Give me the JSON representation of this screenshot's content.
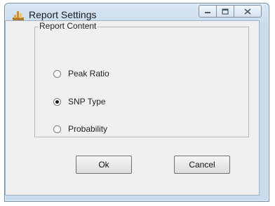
{
  "window": {
    "title": "Report Settings",
    "controls": {
      "minimize_icon": "minimize-icon",
      "maximize_icon": "maximize-icon",
      "close_icon": "close-icon"
    }
  },
  "group": {
    "title": "Report Content",
    "options": [
      {
        "label": "Peak Ratio",
        "checked": false
      },
      {
        "label": "SNP Type",
        "checked": true
      },
      {
        "label": "Probability",
        "checked": false
      }
    ]
  },
  "buttons": {
    "ok": "Ok",
    "cancel": "Cancel"
  },
  "colors": {
    "frame": "#c9dcee",
    "client": "#f0f0f0"
  }
}
